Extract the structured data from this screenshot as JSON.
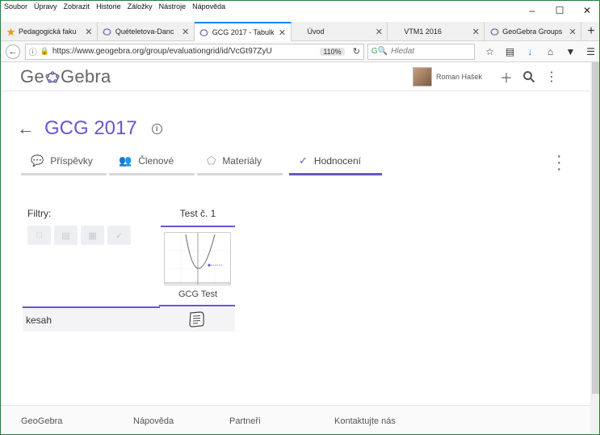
{
  "menubar": {
    "items": [
      "Soubor",
      "Úpravy",
      "Zobrazit",
      "Historie",
      "Záložky",
      "Nástroje",
      "Nápověda"
    ]
  },
  "tabs": [
    {
      "title": "Pedagogická faku",
      "icon": "star-icon"
    },
    {
      "title": "Quételetova-Danc",
      "icon": "geogebra-icon"
    },
    {
      "title": "GCG 2017 - Tabulk",
      "icon": "geogebra-icon",
      "active": true
    },
    {
      "title": "Úvod",
      "icon": ""
    },
    {
      "title": "VTM1 2016",
      "icon": ""
    },
    {
      "title": "GeoGebra Groups",
      "icon": "geogebra-icon"
    }
  ],
  "navbar": {
    "url": "https://www.geogebra.org/group/evaluationgrid/id/VcGt97ZyU",
    "zoom": "110%",
    "search_placeholder": "Hledat"
  },
  "header": {
    "logo_left": "Ge",
    "logo_right": "Gebra",
    "user_name": "Roman Hašek"
  },
  "group": {
    "title": "GCG 2017",
    "tabs": [
      {
        "label": "Příspěvky",
        "icon": "comments-icon"
      },
      {
        "label": "Členové",
        "icon": "members-icon"
      },
      {
        "label": "Materiály",
        "icon": "materials-icon"
      },
      {
        "label": "Hodnocení",
        "icon": "check-icon",
        "active": true
      }
    ]
  },
  "grid": {
    "filters_label": "Filtry:",
    "column_title": "Test č. 1",
    "material_label": "GCG Test",
    "rows": [
      {
        "name": "kesah"
      }
    ]
  },
  "footer": {
    "links": [
      "GeoGebra",
      "Nápověda",
      "Partneři",
      "Kontaktujte nás"
    ]
  },
  "colors": {
    "accent": "#6557d2",
    "tab_highlight": "#0a84ff"
  }
}
